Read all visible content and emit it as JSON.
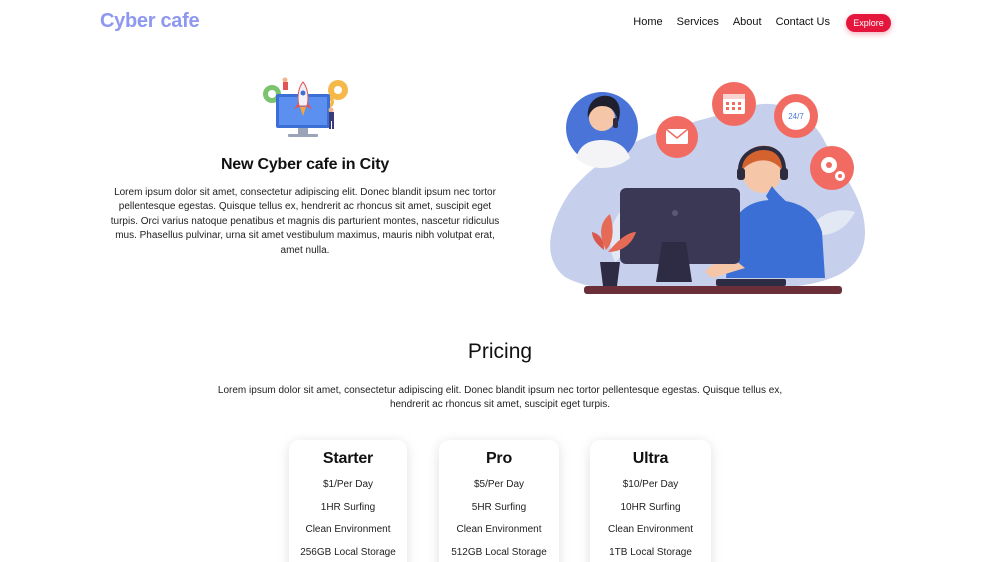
{
  "navbar": {
    "brand": "Cyber cafe",
    "links": [
      "Home",
      "Services",
      "About",
      "Contact Us"
    ],
    "cta": "Explore"
  },
  "hero": {
    "title": "New Cyber cafe in City",
    "text": "Lorem ipsum dolor sit amet, consectetur adipiscing elit. Donec blandit ipsum nec tortor pellentesque egestas. Quisque tellus ex, hendrerit ac rhoncus sit amet, suscipit eget turpis. Orci varius natoque penatibus et magnis dis parturient montes, nascetur ridiculus mus. Phasellus pulvinar, urna sit amet vestibulum maximus, mauris nibh volutpat erat, amet nulla.",
    "illustration_badge": "24/7"
  },
  "pricing": {
    "title": "Pricing",
    "description": "Lorem ipsum dolor sit amet, consectetur adipiscing elit. Donec blandit ipsum nec tortor pellentesque egestas. Quisque tellus ex, hendrerit ac rhoncus sit amet, suscipit eget turpis.",
    "plans": [
      {
        "name": "Starter",
        "features": [
          "$1/Per Day",
          "1HR Surfing",
          "Clean Environment",
          "256GB Local Storage"
        ]
      },
      {
        "name": "Pro",
        "features": [
          "$5/Per Day",
          "5HR Surfing",
          "Clean Environment",
          "512GB Local Storage"
        ]
      },
      {
        "name": "Ultra",
        "features": [
          "$10/Per Day",
          "10HR Surfing",
          "Clean Environment",
          "1TB Local Storage"
        ]
      }
    ]
  },
  "colors": {
    "brand": "#8e98f0",
    "accent": "#e5163b",
    "illustration_blob": "#c6d0ec",
    "illustration_coral": "#f26b63",
    "illustration_blue": "#4a74d8"
  }
}
